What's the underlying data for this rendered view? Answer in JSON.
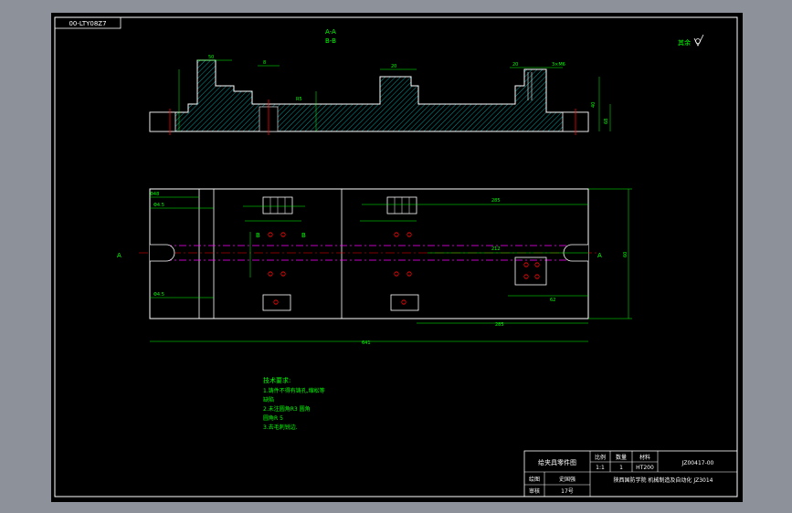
{
  "drawing_code_box": "00-LTY08Z7",
  "section_labels": [
    "A-A",
    "B-B"
  ],
  "roughness_note": "其余",
  "side_dims": [
    "40",
    "68"
  ],
  "top_dims": [
    "50",
    "8",
    "20",
    "20",
    "3×M6",
    "R5"
  ],
  "plan_dims": {
    "left_1": "Φ48",
    "left_2": "Φ4.5",
    "left_3": "Φ4.5",
    "span_right": "285",
    "mid_span": "212",
    "lower_right": "62",
    "long_bottom": "285",
    "overall": "641",
    "height": "60"
  },
  "view_marks": [
    "A",
    "A",
    "B",
    "B"
  ],
  "tech_req": {
    "title": "技术要求:",
    "lines": [
      "1.铸件不得有铸孔,缩松等",
      "缺陷",
      "2.未注圆角R3 圆角",
      "圆角R 5",
      "3.去毛刺锐边."
    ]
  },
  "title_block": {
    "name": "给夹具零件图",
    "headers": [
      "比例",
      "数量",
      "材料"
    ],
    "values": [
      "1:1",
      "1",
      "HT200"
    ],
    "drawing_no": "JZ00417-00",
    "org": "陕西国防学院 机械制造及自动化 JZ3014",
    "roles": [
      "绘图",
      "审核"
    ],
    "people": [
      "史国强",
      "17号"
    ]
  },
  "colors": {
    "outline": "#ffffff",
    "dimension": "#00ff00",
    "centerline": "#ff00ff",
    "hidden": "#ffff00",
    "hatch": "#00ffff",
    "center_red": "#ff0000"
  }
}
